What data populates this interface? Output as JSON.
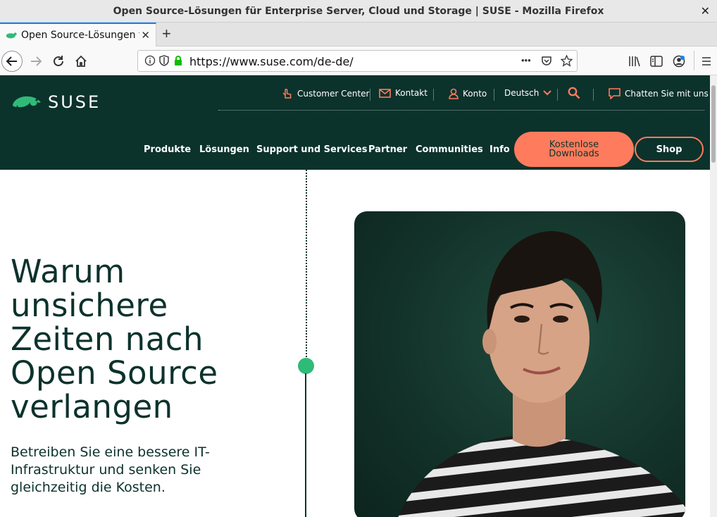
{
  "window": {
    "title": "Open Source-Lösungen für Enterprise Server, Cloud und Storage | SUSE - Mozilla Firefox"
  },
  "tab": {
    "title": "Open Source-Lösungen für Enterprise Server, Cloud und Storage | SUSE"
  },
  "urlbar": {
    "url": "https://www.suse.com/de-de/",
    "more": "•••"
  },
  "header": {
    "logo_text": "SUSE",
    "utility": {
      "customer_center": "Customer Center",
      "contact": "Kontakt",
      "account": "Konto",
      "language": "Deutsch",
      "chat": "Chatten Sie mit uns"
    },
    "nav": [
      "Produkte",
      "Lösungen",
      "Support und Services",
      "Partner",
      "Communities",
      "Info"
    ],
    "downloads_line1": "Kostenlose",
    "downloads_line2": "Downloads",
    "shop": "Shop"
  },
  "hero": {
    "title_lines": [
      "Warum",
      "unsichere",
      "Zeiten nach",
      "Open Source",
      "verlangen"
    ],
    "subtitle": "Betreiben Sie eine bessere IT-Infrastruktur und senken Sie gleichzeitig die Kosten."
  },
  "colors": {
    "brand_dark": "#0c322c",
    "accent": "#fe7c5d",
    "green": "#30ba78",
    "firefox_blue": "#0a84ff"
  }
}
